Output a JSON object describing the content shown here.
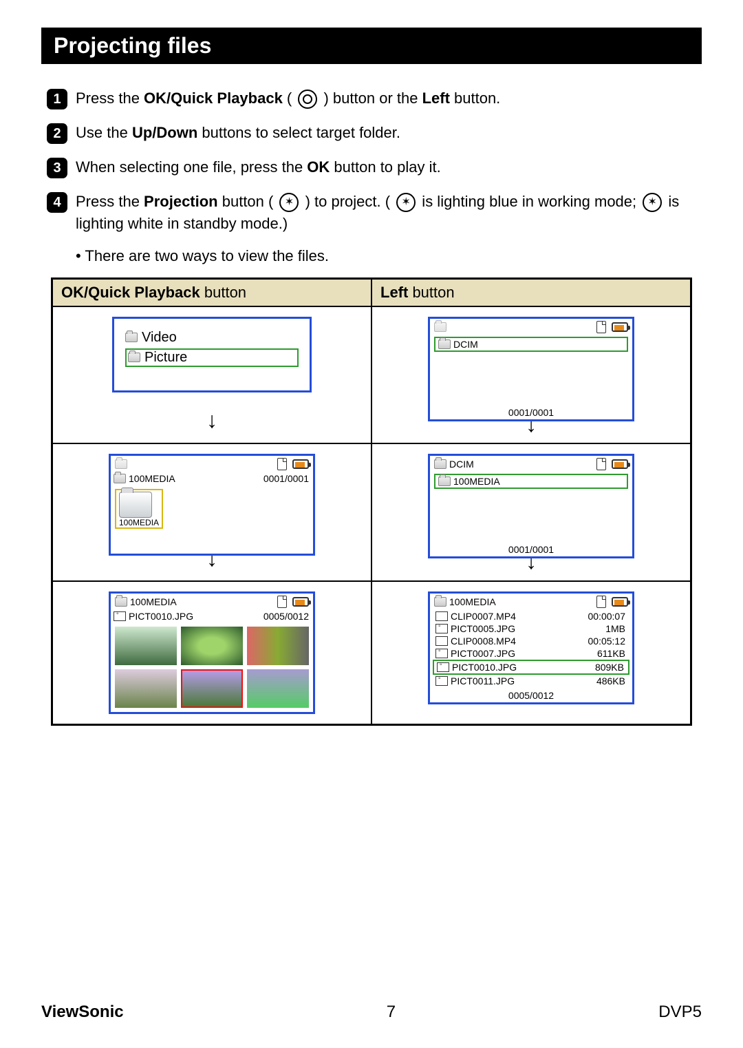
{
  "title": "Projecting files",
  "steps": {
    "s1_pre": "Press the ",
    "s1_bold": "OK/Quick Playback",
    "s1_mid": " ( ",
    "s1_post1": " ) button or the ",
    "s1_bold2": "Left",
    "s1_post2": " button.",
    "s2_pre": "Use the ",
    "s2_bold": "Up/Down",
    "s2_post": " buttons to select target folder.",
    "s3_pre": "When selecting one file, press the ",
    "s3_bold": "OK",
    "s3_post": " button to play it.",
    "s4_pre": "Press the ",
    "s4_bold": "Projection",
    "s4_mid1": " button ( ",
    "s4_mid2": " ) to project. ( ",
    "s4_mid3": " is lighting blue in working mode; ",
    "s4_mid4": " is lighting white in standby mode.)"
  },
  "bullet": "There are two ways to view the files.",
  "table": {
    "head_left_bold": "OK/Quick Playback",
    "head_left_rest": " button",
    "head_right_bold": "Left",
    "head_right_rest": " button"
  },
  "screens": {
    "video": "Video",
    "picture": "Picture",
    "dcim": "DCIM",
    "c0001": "0001/0001",
    "media": "100MEDIA",
    "pict10": "PICT0010.JPG",
    "c0005": "0005/0012",
    "files": [
      {
        "name": "CLIP0007.MP4",
        "meta": "00:00:07",
        "type": "vid"
      },
      {
        "name": "PICT0005.JPG",
        "meta": "1MB",
        "type": "pic"
      },
      {
        "name": "CLIP0008.MP4",
        "meta": "00:05:12",
        "type": "vid"
      },
      {
        "name": "PICT0007.JPG",
        "meta": "611KB",
        "type": "pic"
      },
      {
        "name": "PICT0010.JPG",
        "meta": "809KB",
        "type": "pic",
        "sel": true
      },
      {
        "name": "PICT0011.JPG",
        "meta": "486KB",
        "type": "pic"
      }
    ]
  },
  "footer": {
    "brand": "ViewSonic",
    "page": "7",
    "model": "DVP5"
  }
}
